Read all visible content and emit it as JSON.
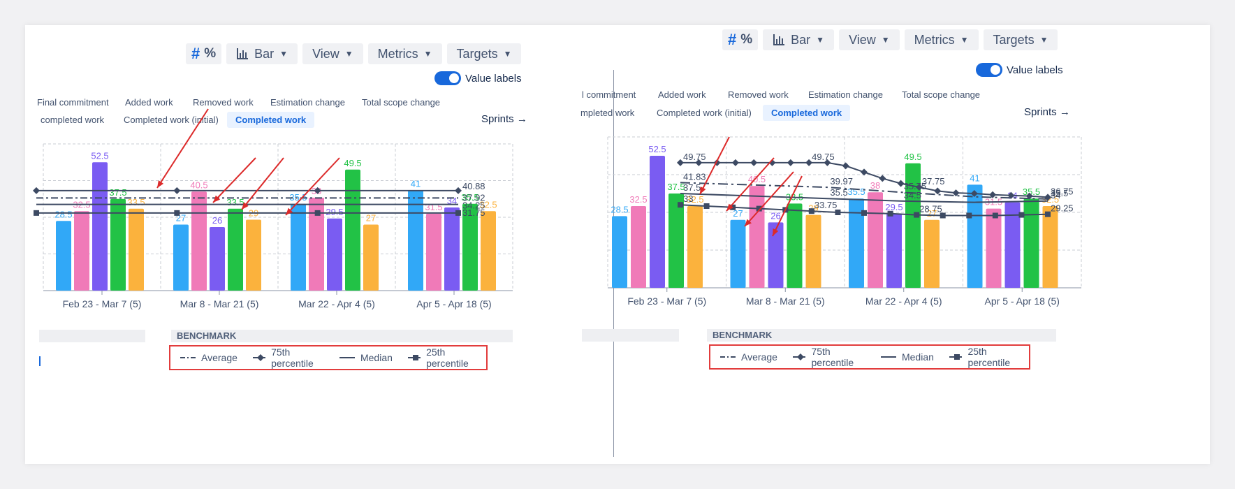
{
  "toolbar": {
    "number_symbol": "#",
    "percent_symbol": "%",
    "bar_label": "Bar",
    "view_label": "View",
    "metrics_label": "Metrics",
    "targets_label": "Targets"
  },
  "value_labels_toggle": {
    "label": "Value labels",
    "on": true
  },
  "left_tabs": {
    "row1": [
      "Final commitment",
      "Added work",
      "Removed work",
      "Estimation change",
      "Total scope change"
    ],
    "row2": [
      "completed work",
      "Completed work (initial)",
      "Completed work"
    ]
  },
  "right_tabs": {
    "row1": [
      "l commitment",
      "Added work",
      "Removed work",
      "Estimation change",
      "Total scope change"
    ],
    "row2": [
      "mpleted work",
      "Completed work (initial)",
      "Completed work"
    ]
  },
  "sprints_link": "Sprints →",
  "benchmark_label": "BENCHMARK",
  "legend": {
    "average": "Average",
    "p75": "75th percentile",
    "median": "Median",
    "p25": "25th percentile"
  },
  "colors": {
    "blue": "#31a8f7",
    "pink": "#f07ab8",
    "purple": "#7a5cf2",
    "green": "#22c246",
    "orange": "#fbb23d",
    "benchmark_line": "#3d4a63",
    "annotation_red": "#dc2a2a",
    "accent": "#1868db"
  },
  "chart_data": [
    {
      "type": "bar",
      "panel": "left",
      "categories": [
        "Feb 23 - Mar 7 (5)",
        "Mar 8 - Mar 21 (5)",
        "Mar 22 - Apr 4 (5)",
        "Apr 5 - Apr 18 (5)"
      ],
      "groups": [
        {
          "category": "Feb 23 - Mar 7 (5)",
          "values": [
            28.5,
            32.5,
            52.5,
            37.5,
            33.5
          ],
          "labels": [
            "28.5",
            "32.5",
            "52.5",
            "37.5",
            "33.5"
          ]
        },
        {
          "category": "Mar 8 - Mar 21 (5)",
          "values": [
            27,
            40.5,
            26,
            33.5,
            29
          ],
          "labels": [
            "27",
            "40.5",
            "26",
            "33.5",
            "29"
          ]
        },
        {
          "category": "Mar 22 - Apr 4 (5)",
          "values": [
            35.5,
            38,
            29.5,
            49.5,
            27
          ],
          "labels": [
            "35.5",
            "38",
            "29.5",
            "49.5",
            "27"
          ]
        },
        {
          "category": "Apr 5 - Apr 18 (5)",
          "values": [
            41,
            31.5,
            34,
            35.5,
            32.5
          ],
          "labels": [
            "41",
            "31.5",
            "34",
            "35.5",
            "32.5"
          ]
        }
      ],
      "benchmarks": {
        "average": {
          "values": [
            37.9,
            37.9,
            37.9,
            37.9
          ],
          "end_label": "37.92"
        },
        "p75": {
          "values": [
            40.88,
            40.88,
            40.88,
            40.88
          ],
          "end_label": "40.88"
        },
        "median": {
          "values": [
            35.25,
            35.25,
            35.25,
            35.25
          ],
          "end_label": "34.25"
        },
        "p25": {
          "values": [
            31.75,
            31.75,
            31.75,
            31.75
          ],
          "end_label": "31.75"
        }
      },
      "ylim": [
        0,
        60
      ],
      "grid": true
    },
    {
      "type": "bar",
      "panel": "right",
      "categories": [
        "Feb 23 - Mar 7 (5)",
        "Mar 8 - Mar 21 (5)",
        "Mar 22 - Apr 4 (5)",
        "Apr 5 - Apr 18 (5)"
      ],
      "groups": [
        {
          "category": "Feb 23 - Mar 7 (5)",
          "values": [
            28.5,
            32.5,
            52.5,
            37.5,
            32.5
          ],
          "labels": [
            "28.5",
            "32.5",
            "52.5",
            "37.5",
            "32.5"
          ]
        },
        {
          "category": "Mar 8 - Mar 21 (5)",
          "values": [
            27,
            40.5,
            26,
            33.5,
            29
          ],
          "labels": [
            "27",
            "40.5",
            "26",
            "33.5",
            "29"
          ]
        },
        {
          "category": "Mar 22 - Apr 4 (5)",
          "values": [
            35.5,
            38,
            29.5,
            49.5,
            27
          ],
          "labels": [
            "35.5",
            "38",
            "29.5",
            "49.5",
            "27"
          ]
        },
        {
          "category": "Apr 5 - Apr 18 (5)",
          "values": [
            41,
            31.5,
            34,
            35.5,
            32.5
          ],
          "labels": [
            "41",
            "31.5",
            "34",
            "35.5",
            "32.5"
          ]
        }
      ],
      "benchmarks": {
        "p75": {
          "values": [
            49.75,
            49.75,
            49.75,
            49.75,
            49.75,
            49.75,
            49.75,
            49.75,
            49.75,
            48.5,
            46.0,
            43.5,
            41.5,
            40.0,
            38.5,
            37.75,
            37.5,
            37.0,
            36.75,
            36.5,
            36.0
          ],
          "point_labels": [
            "49.75",
            "49.75",
            "37.75",
            "36.75"
          ]
        },
        "average": {
          "values": [
            41.83,
            40.9,
            39.97,
            38.0,
            36.2,
            35.3
          ],
          "point_labels": [
            "41.83",
            "39.97",
            "35.75",
            "35.5"
          ]
        },
        "median": {
          "values": [
            37.5,
            36.5,
            35.5,
            34.5,
            34.0,
            34.5
          ],
          "point_labels": [
            "37.5",
            "35.5",
            "34.5",
            "34"
          ]
        },
        "p25": {
          "values": [
            33.0,
            32.5,
            32.0,
            31.5,
            31.0,
            30.5,
            30.0,
            29.75,
            29.5,
            29.0,
            28.75,
            28.75,
            28.75,
            29.0,
            29.25
          ],
          "point_labels": [
            "33",
            "33.75",
            "28.75",
            "29.25"
          ]
        }
      },
      "ylim": [
        0,
        60
      ],
      "grid": true
    }
  ]
}
